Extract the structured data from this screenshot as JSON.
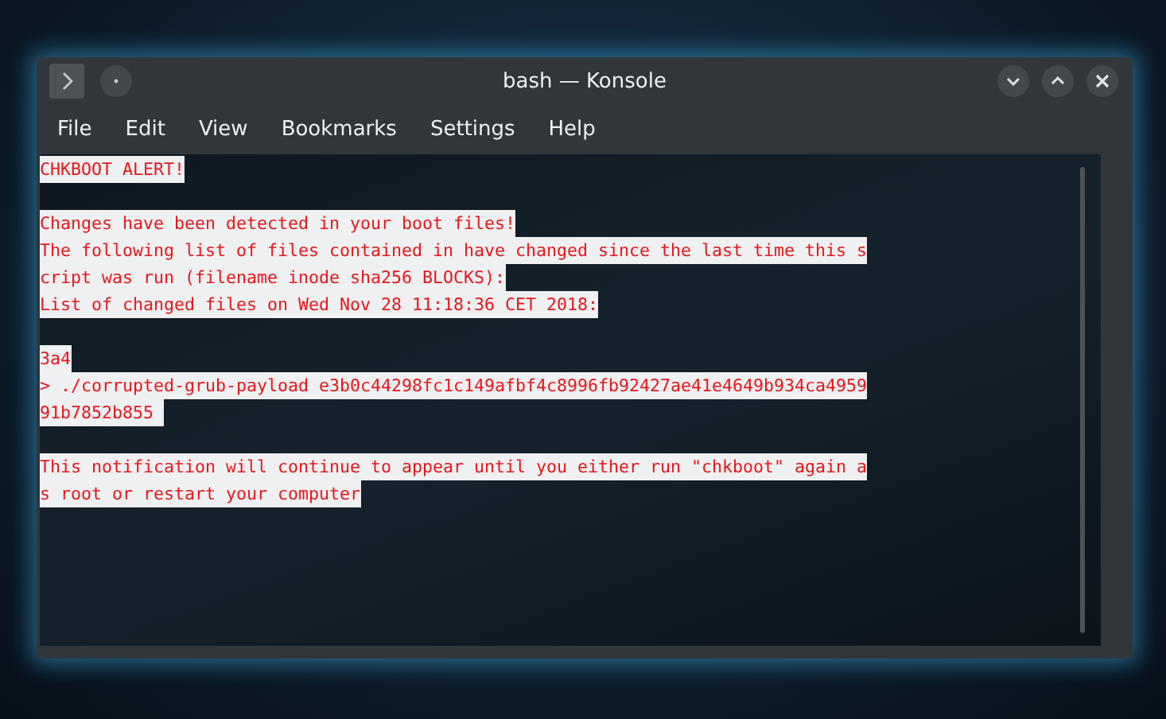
{
  "window": {
    "title": "bash — Konsole"
  },
  "menu": [
    {
      "label": "File"
    },
    {
      "label": "Edit"
    },
    {
      "label": "View"
    },
    {
      "label": "Bookmarks"
    },
    {
      "label": "Settings"
    },
    {
      "label": "Help"
    }
  ],
  "terminal": {
    "blocks": [
      [
        "CHKBOOT ALERT!"
      ],
      [
        "Changes have been detected in your boot files!",
        "The following list of files contained in have changed since the last time this s",
        "cript was run (filename inode sha256 BLOCKS):",
        "List of changed files on Wed Nov 28 11:18:36 CET 2018:"
      ],
      [
        "3a4",
        "> ./corrupted-grub-payload e3b0c44298fc1c149afbf4c8996fb92427ae41e4649b934ca4959",
        "91b7852b855 "
      ],
      [
        "This notification will continue to appear until you either run \"chkboot\" again a",
        "s root or restart your computer"
      ]
    ]
  }
}
